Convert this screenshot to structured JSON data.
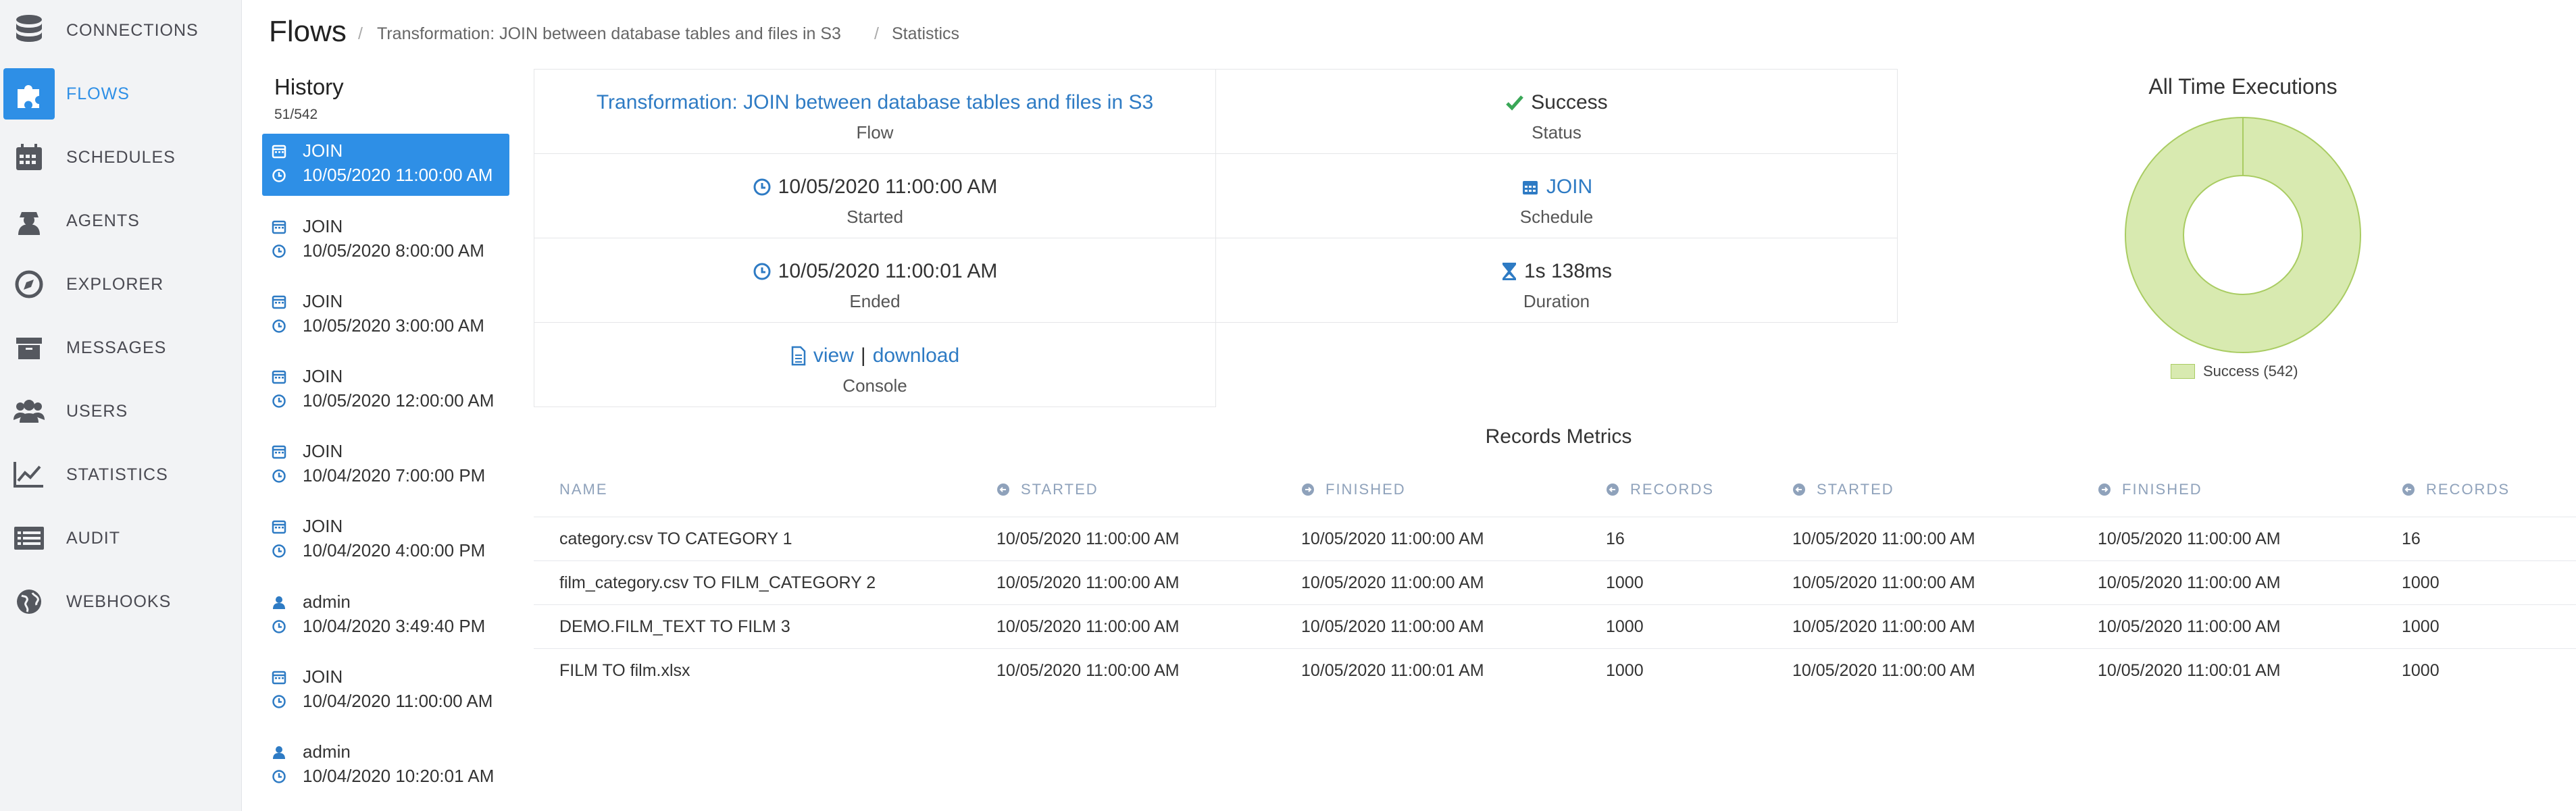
{
  "sidebar": {
    "items": [
      {
        "label": "CONNECTIONS",
        "icon": "database-icon"
      },
      {
        "label": "FLOWS",
        "icon": "puzzle-icon",
        "active": true
      },
      {
        "label": "SCHEDULES",
        "icon": "calendar-icon"
      },
      {
        "label": "AGENTS",
        "icon": "agent-icon"
      },
      {
        "label": "EXPLORER",
        "icon": "compass-icon"
      },
      {
        "label": "MESSAGES",
        "icon": "archive-icon"
      },
      {
        "label": "USERS",
        "icon": "users-icon"
      },
      {
        "label": "STATISTICS",
        "icon": "chart-line-icon"
      },
      {
        "label": "AUDIT",
        "icon": "list-icon"
      },
      {
        "label": "WEBHOOKS",
        "icon": "globe-icon"
      }
    ]
  },
  "header": {
    "title": "Flows",
    "breadcrumb": [
      "Transformation: JOIN between database tables and files in S3",
      "Statistics"
    ]
  },
  "history": {
    "title": "History",
    "count": "51/542",
    "items": [
      {
        "name": "JOIN",
        "kind": "schedule",
        "time": "10/05/2020 11:00:00 AM",
        "active": true
      },
      {
        "name": "JOIN",
        "kind": "schedule",
        "time": "10/05/2020 8:00:00 AM"
      },
      {
        "name": "JOIN",
        "kind": "schedule",
        "time": "10/05/2020 3:00:00 AM"
      },
      {
        "name": "JOIN",
        "kind": "schedule",
        "time": "10/05/2020 12:00:00 AM"
      },
      {
        "name": "JOIN",
        "kind": "schedule",
        "time": "10/04/2020 7:00:00 PM"
      },
      {
        "name": "JOIN",
        "kind": "schedule",
        "time": "10/04/2020 4:00:00 PM"
      },
      {
        "name": "admin",
        "kind": "user",
        "time": "10/04/2020 3:49:40 PM"
      },
      {
        "name": "JOIN",
        "kind": "schedule",
        "time": "10/04/2020 11:00:00 AM"
      },
      {
        "name": "admin",
        "kind": "user",
        "time": "10/04/2020 10:20:01 AM"
      }
    ]
  },
  "info": {
    "flow": {
      "value": "Transformation: JOIN between database tables and files in S3",
      "label": "Flow"
    },
    "status": {
      "value": "Success",
      "label": "Status",
      "color": "#3aa757"
    },
    "started": {
      "value": "10/05/2020 11:00:00 AM",
      "label": "Started"
    },
    "schedule": {
      "value": "JOIN",
      "label": "Schedule"
    },
    "ended": {
      "value": "10/05/2020 11:00:01 AM",
      "label": "Ended"
    },
    "duration": {
      "value": "1s 138ms",
      "label": "Duration"
    },
    "console": {
      "view": "view",
      "sep": "|",
      "download": "download",
      "label": "Console"
    }
  },
  "executions": {
    "title": "All Time Executions",
    "legend": "Success (542)",
    "success_count": 542,
    "color": "#d8eab0",
    "border_color": "#a9cc62"
  },
  "metrics": {
    "title": "Records Metrics",
    "headers": [
      "NAME",
      "STARTED",
      "FINISHED",
      "RECORDS",
      "STARTED",
      "FINISHED",
      "RECORDS"
    ],
    "rows": [
      [
        "category.csv TO CATEGORY 1",
        "10/05/2020 11:00:00 AM",
        "10/05/2020 11:00:00 AM",
        "16",
        "10/05/2020 11:00:00 AM",
        "10/05/2020 11:00:00 AM",
        "16"
      ],
      [
        "film_category.csv TO FILM_CATEGORY 2",
        "10/05/2020 11:00:00 AM",
        "10/05/2020 11:00:00 AM",
        "1000",
        "10/05/2020 11:00:00 AM",
        "10/05/2020 11:00:00 AM",
        "1000"
      ],
      [
        "DEMO.FILM_TEXT TO FILM 3",
        "10/05/2020 11:00:00 AM",
        "10/05/2020 11:00:00 AM",
        "1000",
        "10/05/2020 11:00:00 AM",
        "10/05/2020 11:00:00 AM",
        "1000"
      ],
      [
        "FILM TO film.xlsx",
        "10/05/2020 11:00:00 AM",
        "10/05/2020 11:00:01 AM",
        "1000",
        "10/05/2020 11:00:00 AM",
        "10/05/2020 11:00:01 AM",
        "1000"
      ]
    ]
  }
}
